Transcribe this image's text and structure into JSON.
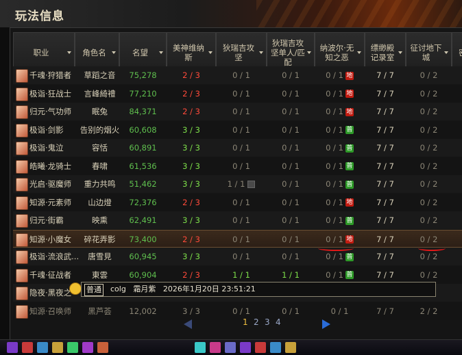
{
  "window": {
    "title": "玩法信息"
  },
  "columns": [
    {
      "label": "职业"
    },
    {
      "label": "角色名"
    },
    {
      "label": "名望"
    },
    {
      "label": "美神维纳斯"
    },
    {
      "label": "狄瑞吉攻坚"
    },
    {
      "label": "狄瑞吉攻坚单人/匹配"
    },
    {
      "label": "纳波尔·无知之恶"
    },
    {
      "label": "缥缈殿记录室"
    },
    {
      "label": "征讨地下城"
    },
    {
      "label": "密"
    }
  ],
  "rows": [
    {
      "job": "千魂·狩猎者",
      "name": "草蹈之音",
      "fame": "75,278",
      "venus": "2 / 3",
      "venus_color": "red",
      "d1": "0 / 1",
      "d2": "0 / 1",
      "nabol": "0 / 1",
      "nabol_badge": "地",
      "nabol_badge_type": "hell",
      "piao": "7 / 7",
      "zt": "0 / 2"
    },
    {
      "job": "极诣·狂战士",
      "name": "言峰綺禮",
      "fame": "77,210",
      "venus": "2 / 3",
      "venus_color": "red",
      "d1": "0 / 1",
      "d2": "0 / 1",
      "nabol": "0 / 1",
      "nabol_badge": "地",
      "nabol_badge_type": "hell",
      "piao": "7 / 7",
      "zt": "0 / 2"
    },
    {
      "job": "归元·气功师",
      "name": "眠兔",
      "fame": "84,371",
      "venus": "2 / 3",
      "venus_color": "red",
      "d1": "0 / 1",
      "d2": "0 / 1",
      "nabol": "0 / 1",
      "nabol_badge": "地",
      "nabol_badge_type": "hell",
      "piao": "7 / 7",
      "zt": "0 / 2"
    },
    {
      "job": "极诣·剑影",
      "name": "告别的烟火",
      "fame": "60,608",
      "venus": "3 / 3",
      "venus_color": "green",
      "d1": "0 / 1",
      "d2": "0 / 1",
      "nabol": "0 / 1",
      "nabol_badge": "普",
      "nabol_badge_type": "norm",
      "piao": "7 / 7",
      "zt": "0 / 2"
    },
    {
      "job": "极诣·鬼泣",
      "name": "容恬",
      "fame": "60,891",
      "venus": "3 / 3",
      "venus_color": "green",
      "d1": "0 / 1",
      "d2": "0 / 1",
      "nabol": "0 / 1",
      "nabol_badge": "普",
      "nabol_badge_type": "norm",
      "piao": "7 / 7",
      "zt": "0 / 2"
    },
    {
      "job": "皓曦·龙骑士",
      "name": "春啸",
      "fame": "61,536",
      "venus": "3 / 3",
      "venus_color": "green",
      "d1": "0 / 1",
      "d2": "0 / 1",
      "nabol": "0 / 1",
      "nabol_badge": "普",
      "nabol_badge_type": "norm",
      "piao": "7 / 7",
      "zt": "0 / 2"
    },
    {
      "job": "光启·驱魔师",
      "name": "重力共鸣",
      "fame": "51,462",
      "venus": "3 / 3",
      "venus_color": "green",
      "d1": "1 / 1",
      "d2": "0 / 1",
      "nabol": "0 / 1",
      "nabol_badge": "普",
      "nabol_badge_type": "norm",
      "piao": "7 / 7",
      "zt": "0 / 2",
      "d1_lock": true
    },
    {
      "job": "知源·元素师",
      "name": "山边燈",
      "fame": "72,376",
      "venus": "2 / 3",
      "venus_color": "red",
      "d1": "0 / 1",
      "d2": "0 / 1",
      "nabol": "0 / 1",
      "nabol_badge": "地",
      "nabol_badge_type": "hell",
      "piao": "7 / 7",
      "zt": "0 / 2"
    },
    {
      "job": "归元·街霸",
      "name": "映熏",
      "fame": "62,491",
      "venus": "3 / 3",
      "venus_color": "green",
      "d1": "0 / 1",
      "d2": "0 / 1",
      "nabol": "0 / 1",
      "nabol_badge": "普",
      "nabol_badge_type": "norm",
      "piao": "7 / 7",
      "zt": "0 / 2"
    },
    {
      "job": "知源·小魔女",
      "name": "碎花弄影",
      "fame": "73,400",
      "venus": "2 / 3",
      "venus_color": "red",
      "d1": "0 / 1",
      "d2": "0 / 1",
      "nabol": "0 / 1",
      "nabol_badge": "地",
      "nabol_badge_type": "hell",
      "piao": "7 / 7",
      "zt": "0 / 2",
      "selected": true
    },
    {
      "job": "极诣·流浪武...",
      "name": "唐雪見",
      "fame": "60,945",
      "venus": "3 / 3",
      "venus_color": "green",
      "d1": "0 / 1",
      "d2": "0 / 1",
      "nabol": "0 / 1",
      "nabol_badge": "普",
      "nabol_badge_type": "norm",
      "piao": "7 / 7",
      "zt": "0 / 2"
    },
    {
      "job": "千魂·征战者",
      "name": "東雲",
      "fame": "60,904",
      "venus": "2 / 3",
      "venus_color": "red",
      "d1": "1 / 1",
      "d2": "1 / 1",
      "nabol": "0 / 1",
      "nabol_badge": "普",
      "nabol_badge_type": "norm",
      "piao": "7 / 7",
      "zt": "0 / 2",
      "d1_green": true
    },
    {
      "job": "隐夜·黑夜之",
      "name": "",
      "fame": "",
      "venus": "",
      "venus_color": "grey",
      "d1": "",
      "d2": "",
      "nabol": "",
      "nabol_badge": "",
      "nabol_badge_type": "",
      "piao": "",
      "zt": "",
      "covered": true
    },
    {
      "job": "知源·召唤师",
      "name": "黑芦荟",
      "fame": "12,002",
      "venus": "3 / 3",
      "venus_color": "grey",
      "d1": "0 / 1",
      "d2": "0 / 1",
      "nabol": "0 / 1",
      "nabol_badge": "",
      "nabol_badge_type": "",
      "piao": "7 / 7",
      "zt": "2 / 2",
      "dim": true
    }
  ],
  "chat": {
    "channel": "普通",
    "sender": "colg",
    "name": "霜月紫",
    "timestamp": "2026年1月20日 23:51:21"
  },
  "pagination": {
    "pages": [
      "1",
      "2",
      "3",
      "4"
    ],
    "current": "1"
  }
}
